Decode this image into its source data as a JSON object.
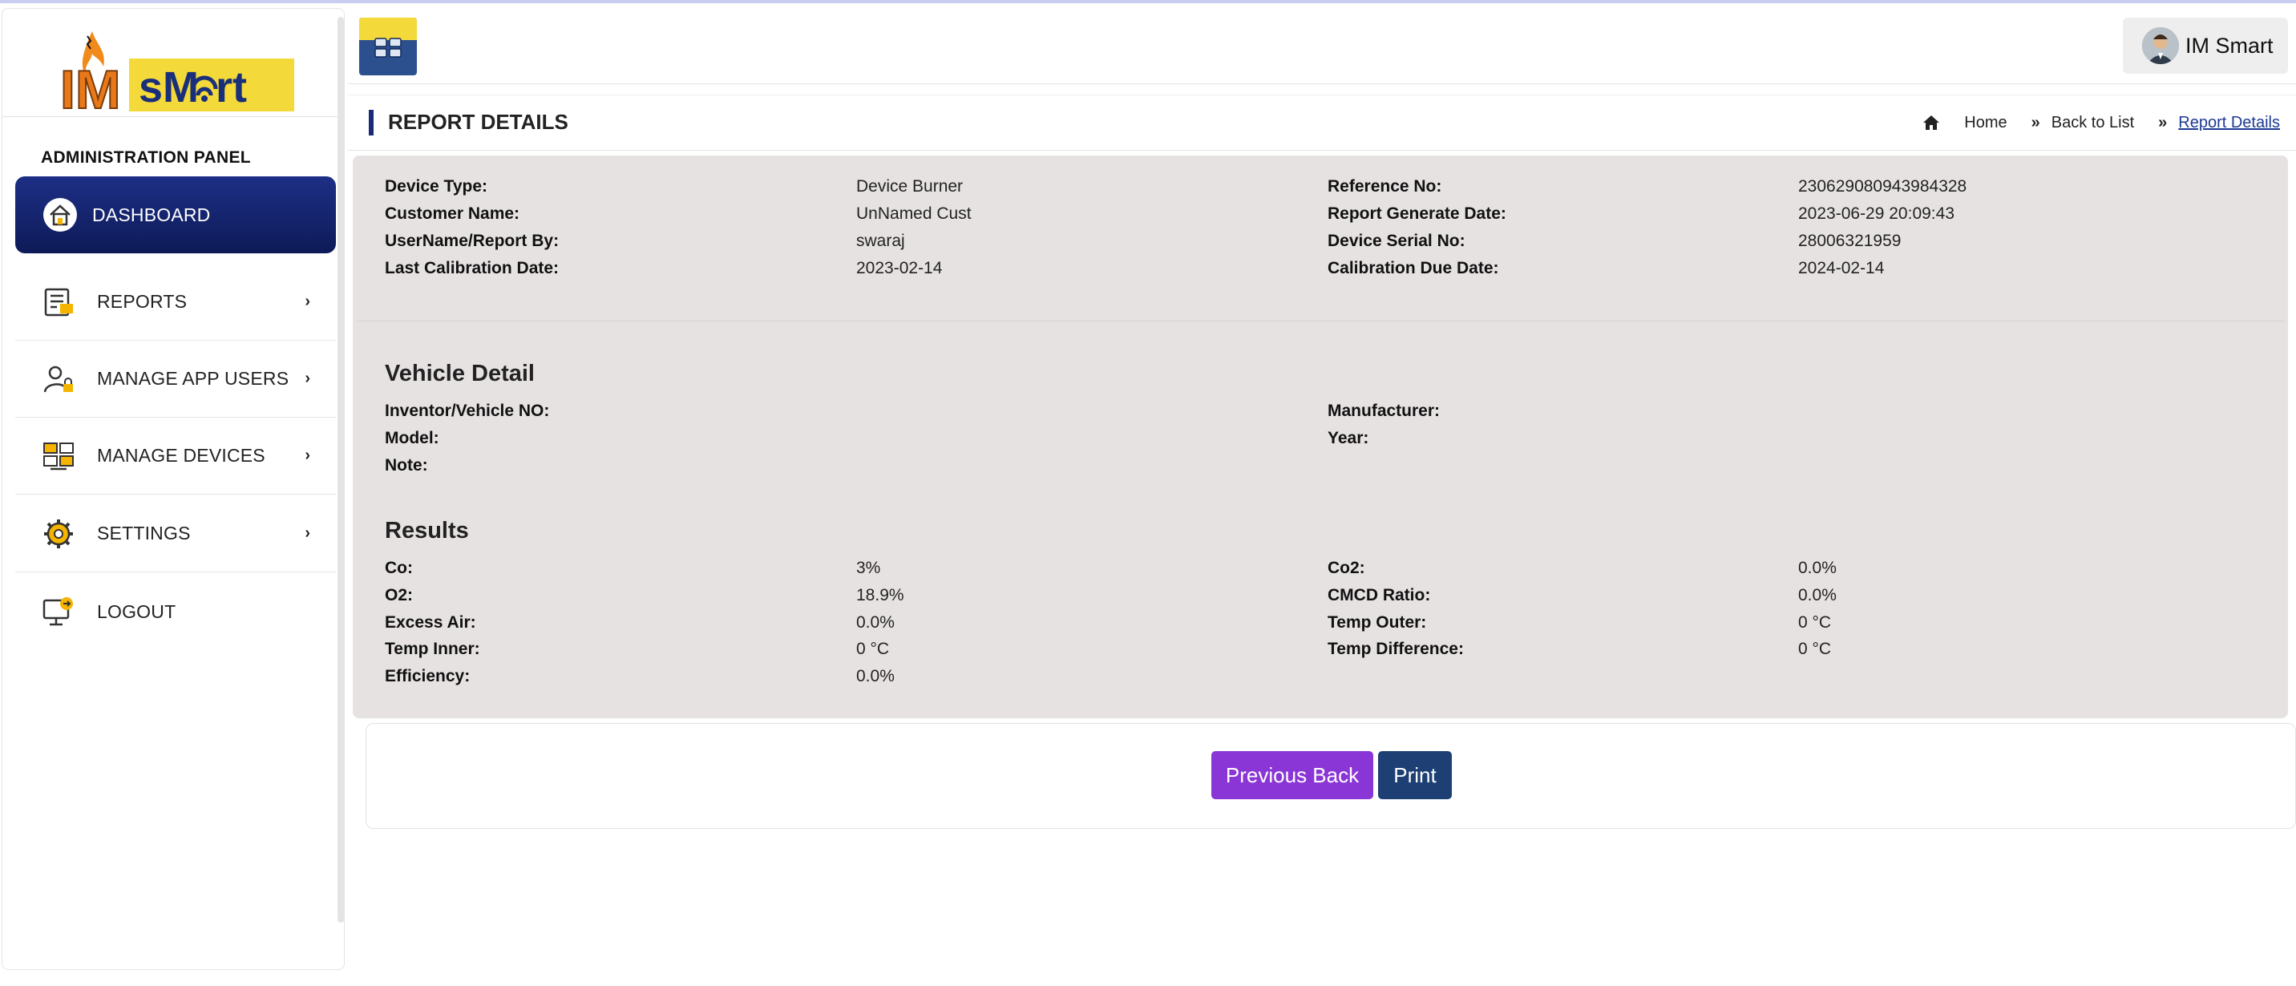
{
  "brand": {
    "logo_left": "IM",
    "logo_right": "sMart",
    "colors": {
      "yellow": "#f4d93a",
      "orange": "#f08a1c",
      "navy": "#1a2a78"
    }
  },
  "sidebar": {
    "panel_title": "ADMINISTRATION PANEL",
    "items": [
      {
        "label": "DASHBOARD",
        "icon": "home-icon",
        "active": true,
        "has_chevron": false
      },
      {
        "label": "REPORTS",
        "icon": "reports-icon",
        "active": false,
        "has_chevron": true
      },
      {
        "label": "MANAGE APP USERS",
        "icon": "user-lock-icon",
        "active": false,
        "has_chevron": true
      },
      {
        "label": "MANAGE DEVICES",
        "icon": "devices-icon",
        "active": false,
        "has_chevron": true
      },
      {
        "label": "SETTINGS",
        "icon": "gear-icon",
        "active": false,
        "has_chevron": true
      },
      {
        "label": "LOGOUT",
        "icon": "logout-icon",
        "active": false,
        "has_chevron": false
      }
    ]
  },
  "header": {
    "user_name": "IM Smart"
  },
  "page": {
    "title": "REPORT DETAILS",
    "breadcrumbs": {
      "home": "Home",
      "back": "Back to List",
      "current": "Report Details"
    }
  },
  "report": {
    "device_type_label": "Device Type:",
    "device_type": "Device Burner",
    "reference_no_label": "Reference No:",
    "reference_no": "230629080943984328",
    "customer_name_label": "Customer Name:",
    "customer_name": "UnNamed Cust",
    "report_date_label": "Report Generate Date:",
    "report_date": "2023-06-29 20:09:43",
    "username_label": "UserName/Report By:",
    "username": "swaraj",
    "serial_label": "Device Serial No:",
    "serial": "28006321959",
    "last_cal_label": "Last Calibration Date:",
    "last_cal": "2023-02-14",
    "cal_due_label": "Calibration Due Date:",
    "cal_due": "2024-02-14"
  },
  "vehicle": {
    "heading": "Vehicle Detail",
    "inventor_label": "Inventor/Vehicle NO:",
    "inventor": "",
    "manufacturer_label": "Manufacturer:",
    "manufacturer": "",
    "model_label": "Model:",
    "model": "",
    "year_label": "Year:",
    "year": "",
    "note_label": "Note:",
    "note": ""
  },
  "results": {
    "heading": "Results",
    "co_label": "Co:",
    "co": "3%",
    "co2_label": "Co2:",
    "co2": "0.0%",
    "o2_label": "O2:",
    "o2": "18.9%",
    "cmcd_label": "CMCD Ratio:",
    "cmcd": "0.0%",
    "excess_label": "Excess Air:",
    "excess": "0.0%",
    "temp_outer_label": "Temp Outer:",
    "temp_outer": "0 °C",
    "temp_inner_label": "Temp Inner:",
    "temp_inner": "0 °C",
    "temp_diff_label": "Temp Difference:",
    "temp_diff": "0 °C",
    "efficiency_label": "Efficiency:",
    "efficiency": "0.0%"
  },
  "buttons": {
    "back": "Previous Back",
    "print": "Print"
  }
}
